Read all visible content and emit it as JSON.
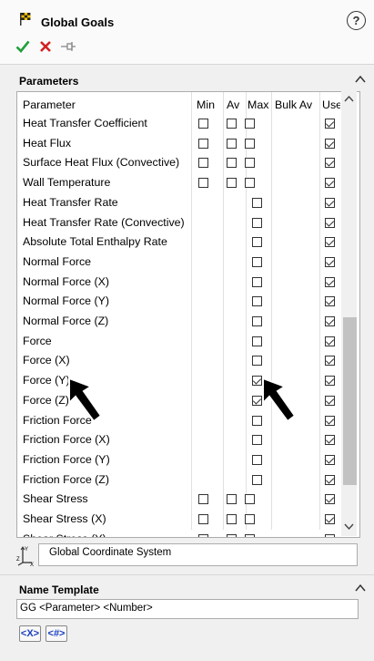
{
  "header": {
    "title": "Global Goals",
    "help": "?"
  },
  "parameters_section": {
    "title": "Parameters"
  },
  "table": {
    "columns": [
      "Parameter",
      "Min",
      "Av",
      "Max",
      "Bulk Av",
      "Use"
    ],
    "rows": [
      {
        "name": "Heat Transfer Coefficient",
        "min": false,
        "av": false,
        "max": false,
        "use": true,
        "min_av_enabled": true
      },
      {
        "name": "Heat Flux",
        "min": false,
        "av": false,
        "max": false,
        "use": true,
        "min_av_enabled": true
      },
      {
        "name": "Surface Heat Flux (Convective)",
        "min": false,
        "av": false,
        "max": false,
        "use": true,
        "min_av_enabled": true
      },
      {
        "name": "Wall Temperature",
        "min": false,
        "av": false,
        "max": false,
        "use": true,
        "min_av_enabled": true
      },
      {
        "name": "Heat Transfer Rate",
        "max": false,
        "use": true,
        "min_av_enabled": false
      },
      {
        "name": "Heat Transfer Rate (Convective)",
        "max": false,
        "use": true,
        "min_av_enabled": false
      },
      {
        "name": "Absolute Total Enthalpy Rate",
        "max": false,
        "use": true,
        "min_av_enabled": false
      },
      {
        "name": "Normal Force",
        "max": false,
        "use": true,
        "min_av_enabled": false
      },
      {
        "name": "Normal Force (X)",
        "max": false,
        "use": true,
        "min_av_enabled": false
      },
      {
        "name": "Normal Force (Y)",
        "max": false,
        "use": true,
        "min_av_enabled": false
      },
      {
        "name": "Normal Force (Z)",
        "max": false,
        "use": true,
        "min_av_enabled": false
      },
      {
        "name": "Force",
        "max": false,
        "use": true,
        "min_av_enabled": false
      },
      {
        "name": "Force (X)",
        "max": false,
        "use": true,
        "min_av_enabled": false
      },
      {
        "name": "Force (Y)",
        "max": true,
        "use": true,
        "min_av_enabled": false
      },
      {
        "name": "Force (Z)",
        "max": true,
        "use": true,
        "min_av_enabled": false
      },
      {
        "name": "Friction Force",
        "max": false,
        "use": true,
        "min_av_enabled": false
      },
      {
        "name": "Friction Force (X)",
        "max": false,
        "use": true,
        "min_av_enabled": false
      },
      {
        "name": "Friction Force (Y)",
        "max": false,
        "use": true,
        "min_av_enabled": false
      },
      {
        "name": "Friction Force (Z)",
        "max": false,
        "use": true,
        "min_av_enabled": false
      },
      {
        "name": "Shear Stress",
        "min": false,
        "av": false,
        "max": false,
        "use": true,
        "min_av_enabled": true
      },
      {
        "name": "Shear Stress (X)",
        "min": false,
        "av": false,
        "max": false,
        "use": true,
        "min_av_enabled": true
      },
      {
        "name": "Shear Stress (Y)",
        "min": false,
        "av": false,
        "max": false,
        "use": true,
        "min_av_enabled": true
      }
    ]
  },
  "coordinate_system": {
    "value": "Global Coordinate System"
  },
  "name_template_section": {
    "title": "Name Template",
    "value": "GG <Parameter> <Number>"
  },
  "tokens": {
    "x": "<X>",
    "hash": "<#>"
  },
  "colors": {
    "ok": "#22a03a",
    "cancel": "#d42020",
    "accent": "#1a3fbf"
  }
}
